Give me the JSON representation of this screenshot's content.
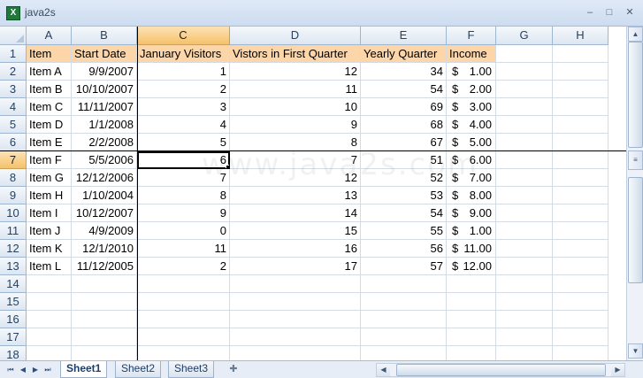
{
  "window": {
    "title": "java2s",
    "minimize_glyph": "–",
    "maximize_glyph": "□",
    "close_glyph": "✕",
    "app_icon_glyph": "X"
  },
  "columns": [
    {
      "letter": "A",
      "width": 51
    },
    {
      "letter": "B",
      "width": 74
    },
    {
      "letter": "C",
      "width": 105
    },
    {
      "letter": "D",
      "width": 148
    },
    {
      "letter": "E",
      "width": 97
    },
    {
      "letter": "F",
      "width": 56
    },
    {
      "letter": "G",
      "width": 64
    },
    {
      "letter": "H",
      "width": 63
    }
  ],
  "selected_column": "C",
  "selected_row": 7,
  "row_numbers": [
    "1",
    "2",
    "3",
    "4",
    "5",
    "6",
    "7",
    "8",
    "9",
    "10",
    "11",
    "12",
    "13",
    "14",
    "15",
    "16",
    "17",
    "18"
  ],
  "headers": [
    "Item",
    "Start Date",
    "January Visitors",
    "Vistors in First Quarter",
    "Yearly Quarter",
    "Income"
  ],
  "rows": [
    [
      "Item A",
      "9/9/2007",
      "1",
      "12",
      "34",
      "1.00"
    ],
    [
      "Item B",
      "10/10/2007",
      "2",
      "11",
      "54",
      "2.00"
    ],
    [
      "Item C",
      "11/11/2007",
      "3",
      "10",
      "69",
      "3.00"
    ],
    [
      "Item D",
      "1/1/2008",
      "4",
      "9",
      "68",
      "4.00"
    ],
    [
      "Item E",
      "2/2/2008",
      "5",
      "8",
      "67",
      "5.00"
    ],
    [
      "Item F",
      "5/5/2006",
      "6",
      "7",
      "51",
      "6.00"
    ],
    [
      "Item G",
      "12/12/2006",
      "7",
      "12",
      "52",
      "7.00"
    ],
    [
      "Item H",
      "1/10/2004",
      "8",
      "13",
      "53",
      "8.00"
    ],
    [
      "Item I",
      "10/12/2007",
      "9",
      "14",
      "54",
      "9.00"
    ],
    [
      "Item J",
      "4/9/2009",
      "0",
      "15",
      "55",
      "1.00"
    ],
    [
      "Item K",
      "12/1/2010",
      "11",
      "16",
      "56",
      "11.00"
    ],
    [
      "Item L",
      "11/12/2005",
      "2",
      "17",
      "57",
      "12.00"
    ]
  ],
  "currency_symbol": "$",
  "sheets": [
    "Sheet1",
    "Sheet2",
    "Sheet3"
  ],
  "active_sheet": "Sheet1",
  "nav": {
    "first": "⏮",
    "prev": "◀",
    "next": "▶",
    "last": "⏭"
  },
  "watermark": "www.java2s.com",
  "colors": {
    "header_fill": "#fcd5a8",
    "selected_header": "#f6c16b",
    "gridline": "#d4dbe4"
  }
}
